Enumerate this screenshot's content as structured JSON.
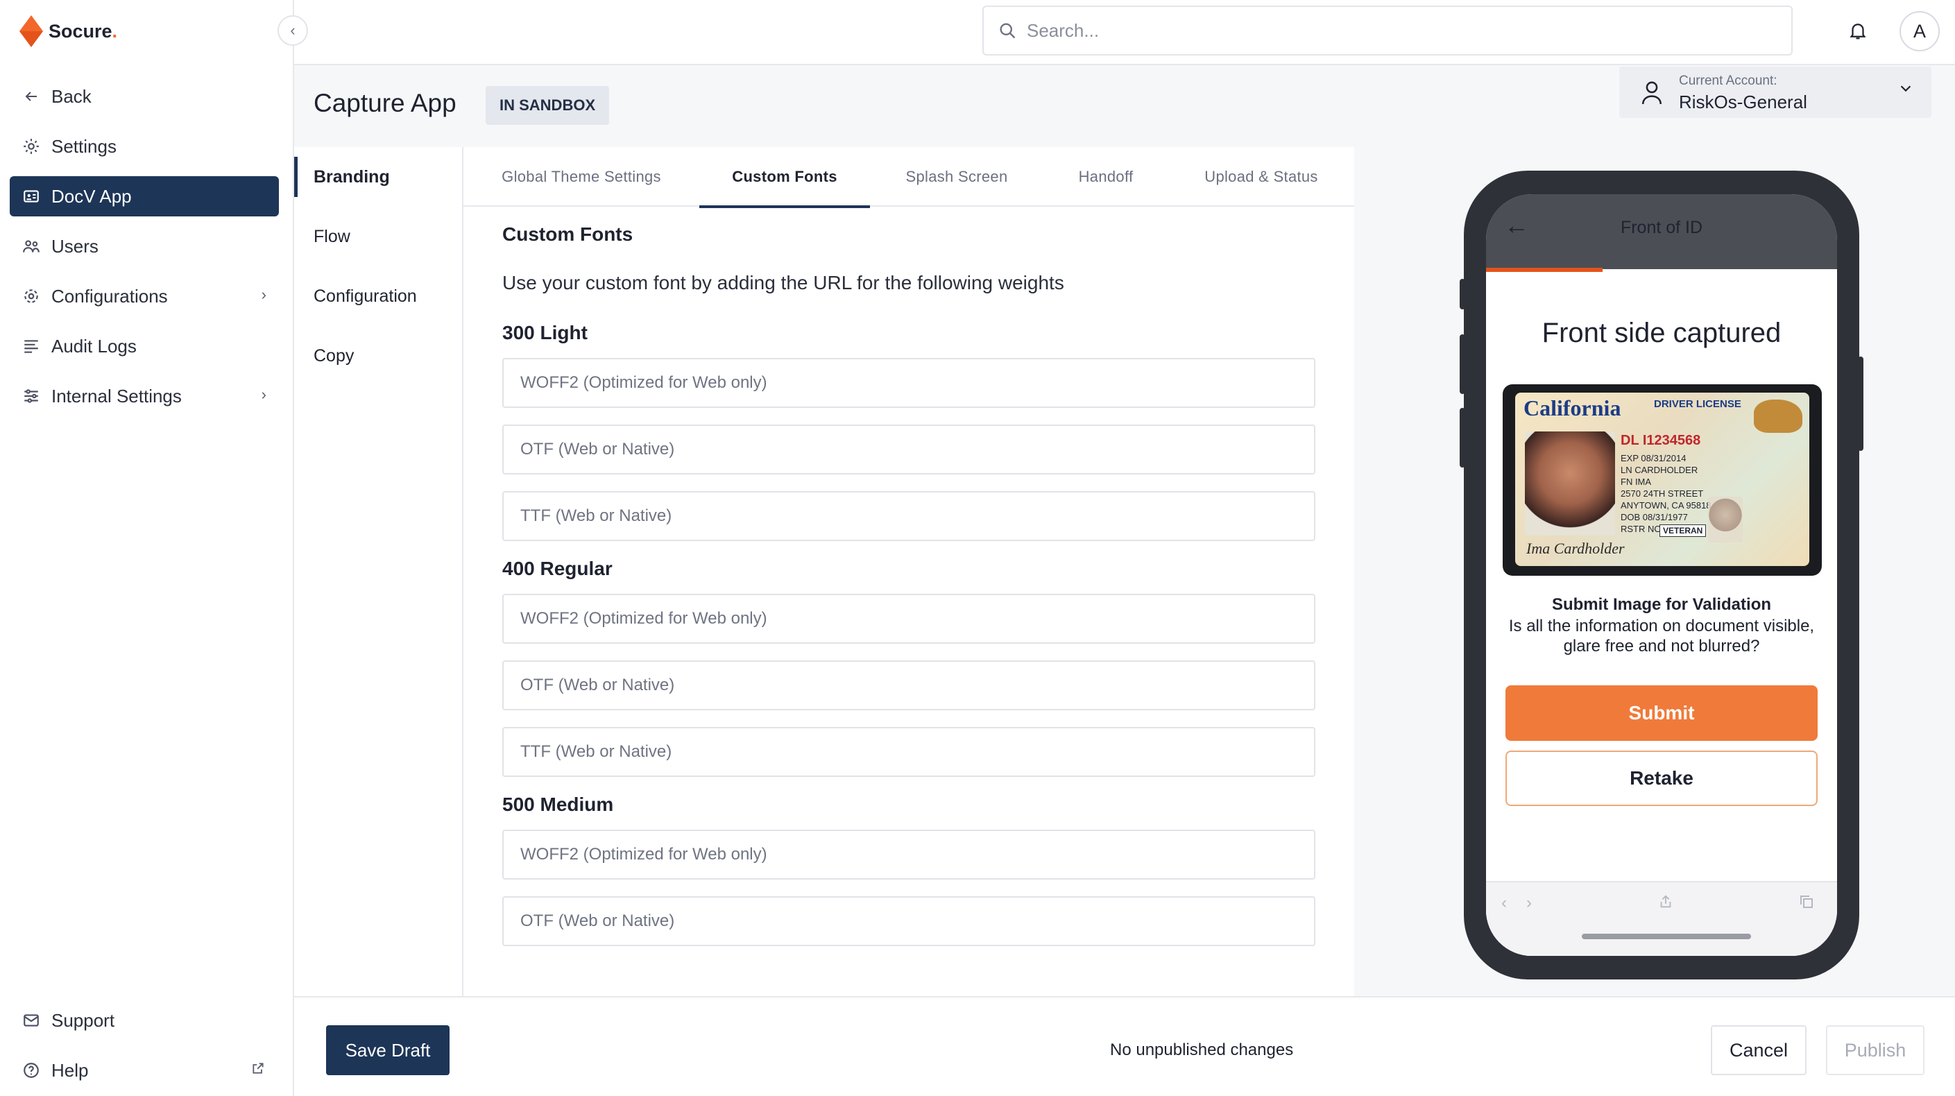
{
  "app": {
    "logo_text": "Socure",
    "logo_suffix": "."
  },
  "sidebar": {
    "items": [
      {
        "label": "Back",
        "icon": "arrow-left-icon"
      },
      {
        "label": "Settings",
        "icon": "gear-icon"
      },
      {
        "label": "DocV App",
        "icon": "id-card-icon",
        "active": true
      },
      {
        "label": "Users",
        "icon": "users-icon"
      },
      {
        "label": "Configurations",
        "icon": "sliders-icon",
        "has_children": true
      },
      {
        "label": "Audit Logs",
        "icon": "list-icon"
      },
      {
        "label": "Internal Settings",
        "icon": "tune-icon",
        "has_children": true
      }
    ],
    "bottom": [
      {
        "label": "Support",
        "icon": "mail-icon"
      },
      {
        "label": "Help",
        "icon": "help-circle-icon",
        "external": true
      }
    ]
  },
  "topbar": {
    "search_placeholder": "Search...",
    "avatar_initial": "A"
  },
  "header": {
    "title": "Capture App",
    "badge": "IN SANDBOX",
    "account_label": "Current Account:",
    "account_value": "RiskOs-General"
  },
  "submenu": {
    "items": [
      {
        "label": "Branding",
        "active": true
      },
      {
        "label": "Flow"
      },
      {
        "label": "Configuration"
      },
      {
        "label": "Copy"
      }
    ]
  },
  "tabs": [
    {
      "label": "Global Theme Settings"
    },
    {
      "label": "Custom Fonts",
      "active": true
    },
    {
      "label": "Splash Screen"
    },
    {
      "label": "Handoff"
    },
    {
      "label": "Upload & Status"
    }
  ],
  "content": {
    "heading": "Custom Fonts",
    "description": "Use your custom font by adding the URL for the following weights",
    "groups": [
      {
        "title": "300 Light",
        "fields": [
          "WOFF2 (Optimized for Web only)",
          "OTF (Web or Native)",
          "TTF (Web or Native)"
        ]
      },
      {
        "title": "400 Regular",
        "fields": [
          "WOFF2 (Optimized for Web only)",
          "OTF (Web or Native)",
          "TTF (Web or Native)"
        ]
      },
      {
        "title": "500 Medium",
        "fields": [
          "WOFF2 (Optimized for Web only)",
          "OTF (Web or Native)"
        ]
      }
    ]
  },
  "preview": {
    "screen_title": "Front of ID",
    "sheet_title": "Front side captured",
    "id_state": "California",
    "id_type": "DRIVER LICENSE",
    "id_number": "DL I1234568",
    "id_lines": [
      "EXP 08/31/2014",
      "LN CARDHOLDER",
      "FN IMA",
      "2570 24TH STREET",
      "ANYTOWN, CA 95818",
      "DOB 08/31/1977",
      "RSTR NONE"
    ],
    "id_veteran": "VETERAN",
    "id_signature": "Ima Cardholder",
    "prompt_title": "Submit Image for Validation",
    "prompt_body": "Is all the information on document visible, glare free and not blurred?",
    "submit_label": "Submit",
    "retake_label": "Retake"
  },
  "bottombar": {
    "save_draft": "Save Draft",
    "status": "No unpublished changes",
    "cancel": "Cancel",
    "publish": "Publish"
  },
  "colors": {
    "navy": "#1d3557",
    "orange": "#f07a3a",
    "brand_orange": "#f2682a"
  }
}
